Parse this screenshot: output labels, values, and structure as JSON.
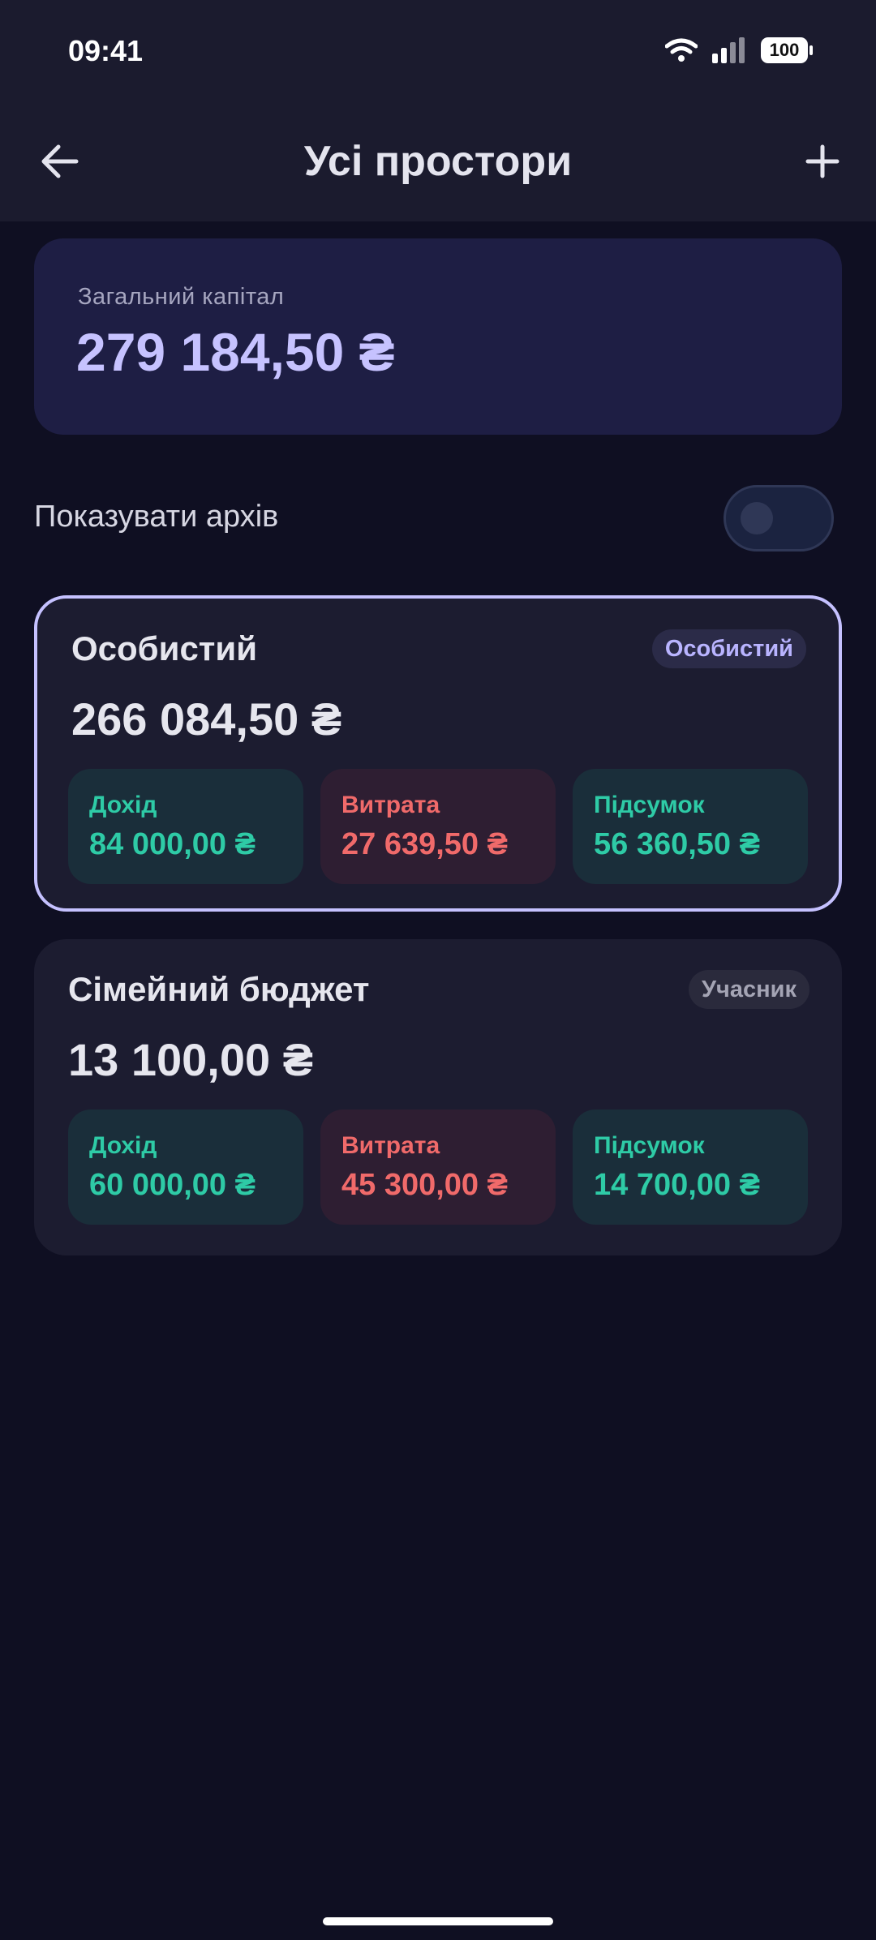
{
  "status_bar": {
    "time": "09:41",
    "battery": "100"
  },
  "header": {
    "title": "Усі простори"
  },
  "capital": {
    "label": "Загальний капітал",
    "value": "279 184,50 ₴"
  },
  "archive": {
    "label": "Показувати архів",
    "enabled": false
  },
  "spaces": [
    {
      "name": "Особистий",
      "badge": "Особистий",
      "total": "266 084,50 ₴",
      "selected": true,
      "income_label": "Дохід",
      "income": "84 000,00 ₴",
      "expense_label": "Витрата",
      "expense": "27 639,50 ₴",
      "balance_label": "Підсумок",
      "balance": "56 360,50 ₴"
    },
    {
      "name": "Сімейний бюджет",
      "badge": "Учасник",
      "total": "13 100,00 ₴",
      "selected": false,
      "income_label": "Дохід",
      "income": "60 000,00 ₴",
      "expense_label": "Витрата",
      "expense": "45 300,00 ₴",
      "balance_label": "Підсумок",
      "balance": "14 700,00 ₴"
    }
  ],
  "colors": {
    "accent": "#c6c2ff",
    "income": "#2ecba6",
    "expense": "#f06a6a",
    "income_bg": "#1a2e3a",
    "expense_bg": "#2e1e32"
  }
}
